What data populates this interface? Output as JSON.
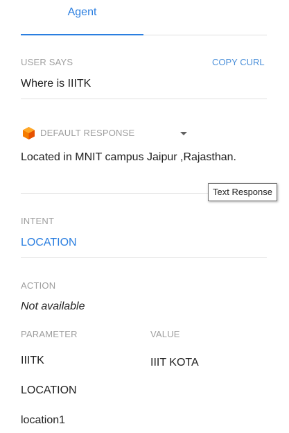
{
  "tab": {
    "label": "Agent"
  },
  "user_says": {
    "label": "USER SAYS",
    "copy_curl": "COPY CURL",
    "text": "Where is IIITK"
  },
  "response": {
    "label": "DEFAULT RESPONSE",
    "icon": "cube-icon",
    "icon_color": "#f57c00",
    "text": "Located in MNIT campus Jaipur ,Rajasthan.",
    "tooltip": "Text Response"
  },
  "intent": {
    "label": "INTENT",
    "value": "LOCATION"
  },
  "action": {
    "label": "ACTION",
    "value": "Not available"
  },
  "parameters": {
    "header_param": "PARAMETER",
    "header_value": "VALUE",
    "rows": [
      {
        "name": "IIITK",
        "value": "IIIT KOTA"
      },
      {
        "name": "LOCATION",
        "value": ""
      },
      {
        "name": "location1",
        "value": ""
      }
    ]
  },
  "colors": {
    "accent": "#2a7ee0",
    "label": "#9e9e9e",
    "divider": "#e0e0e0"
  }
}
